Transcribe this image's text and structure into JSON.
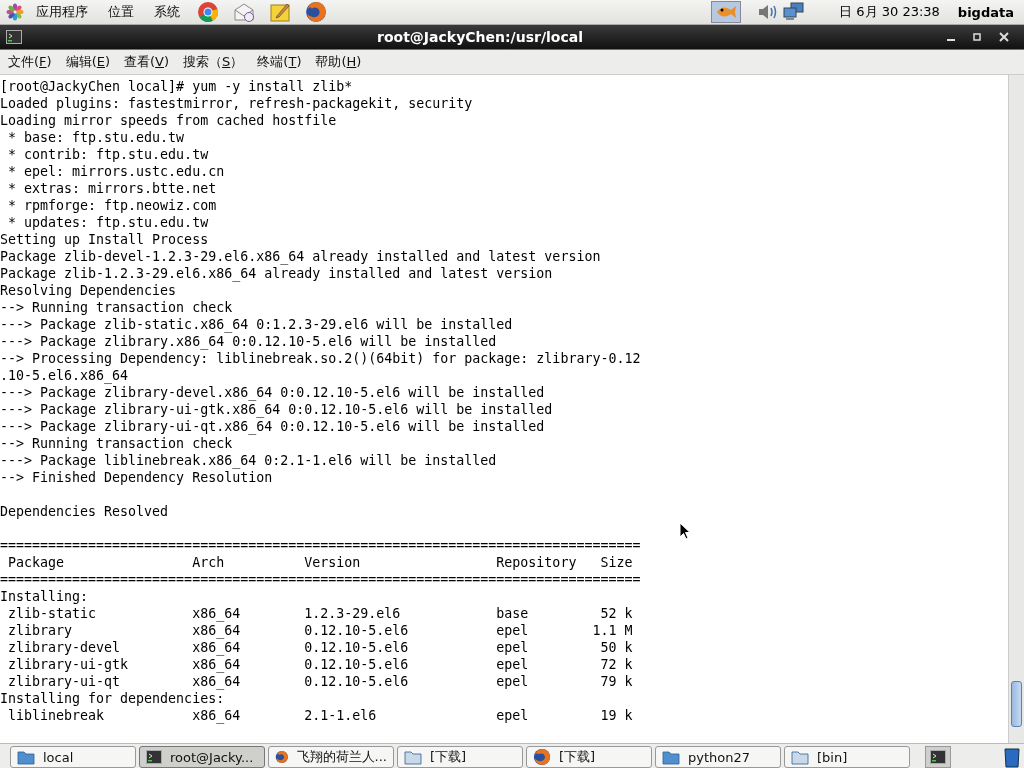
{
  "top_panel": {
    "menus": [
      "应用程序",
      "位置",
      "系统"
    ],
    "launchers": [
      {
        "kind": "chrome"
      },
      {
        "kind": "mail"
      },
      {
        "kind": "notes"
      },
      {
        "kind": "firefox"
      }
    ],
    "clock": "日 6月 30 23:38",
    "user": "bigdata"
  },
  "window": {
    "title": "root@JackyChen:/usr/local"
  },
  "menu_bar": [
    {
      "label": "文件(",
      "key": "F",
      "end": ")"
    },
    {
      "label": "编辑(",
      "key": "E",
      "end": ")"
    },
    {
      "label": "查看(",
      "key": "V",
      "end": ")"
    },
    {
      "label": "搜索（",
      "key": "S",
      "end": "）"
    },
    {
      "label": "终端(",
      "key": "T",
      "end": ")"
    },
    {
      "label": "帮助(",
      "key": "H",
      "end": ")"
    }
  ],
  "terminal_lines": [
    {
      "kind": "text",
      "text": "[root@JackyChen local]# yum -y install zlib*"
    },
    {
      "kind": "text",
      "text": "Loaded plugins: fastestmirror, refresh-packagekit, security"
    },
    {
      "kind": "text",
      "text": "Loading mirror speeds from cached hostfile"
    },
    {
      "kind": "text",
      "text": " * base: ftp.stu.edu.tw"
    },
    {
      "kind": "text",
      "text": " * contrib: ftp.stu.edu.tw"
    },
    {
      "kind": "text",
      "text": " * epel: mirrors.ustc.edu.cn"
    },
    {
      "kind": "text",
      "text": " * extras: mirrors.btte.net"
    },
    {
      "kind": "text",
      "text": " * rpmforge: ftp.neowiz.com"
    },
    {
      "kind": "text",
      "text": " * updates: ftp.stu.edu.tw"
    },
    {
      "kind": "text",
      "text": "Setting up Install Process"
    },
    {
      "kind": "text",
      "text": "Package zlib-devel-1.2.3-29.el6.x86_64 already installed and latest version"
    },
    {
      "kind": "text",
      "text": "Package zlib-1.2.3-29.el6.x86_64 already installed and latest version"
    },
    {
      "kind": "text",
      "text": "Resolving Dependencies"
    },
    {
      "kind": "text",
      "text": "--> Running transaction check"
    },
    {
      "kind": "text",
      "text": "---> Package zlib-static.x86_64 0:1.2.3-29.el6 will be installed"
    },
    {
      "kind": "text",
      "text": "---> Package zlibrary.x86_64 0:0.12.10-5.el6 will be installed"
    },
    {
      "kind": "text",
      "text": "--> Processing Dependency: liblinebreak.so.2()(64bit) for package: zlibrary-0.12"
    },
    {
      "kind": "text",
      "text": ".10-5.el6.x86_64"
    },
    {
      "kind": "text",
      "text": "---> Package zlibrary-devel.x86_64 0:0.12.10-5.el6 will be installed"
    },
    {
      "kind": "text",
      "text": "---> Package zlibrary-ui-gtk.x86_64 0:0.12.10-5.el6 will be installed"
    },
    {
      "kind": "text",
      "text": "---> Package zlibrary-ui-qt.x86_64 0:0.12.10-5.el6 will be installed"
    },
    {
      "kind": "text",
      "text": "--> Running transaction check"
    },
    {
      "kind": "text",
      "text": "---> Package liblinebreak.x86_64 0:2.1-1.el6 will be installed"
    },
    {
      "kind": "text",
      "text": "--> Finished Dependency Resolution"
    },
    {
      "kind": "blank"
    },
    {
      "kind": "text",
      "text": "Dependencies Resolved"
    },
    {
      "kind": "blank"
    },
    {
      "kind": "text",
      "text": "================================================================================"
    },
    {
      "kind": "text",
      "text": " Package                Arch          Version                 Repository   Size"
    },
    {
      "kind": "text",
      "text": "================================================================================"
    },
    {
      "kind": "text",
      "text": "Installing:"
    },
    {
      "kind": "text",
      "text": " zlib-static            x86_64        1.2.3-29.el6            base         52 k"
    },
    {
      "kind": "text",
      "text": " zlibrary               x86_64        0.12.10-5.el6           epel        1.1 M"
    },
    {
      "kind": "text",
      "text": " zlibrary-devel         x86_64        0.12.10-5.el6           epel         50 k"
    },
    {
      "kind": "text",
      "text": " zlibrary-ui-gtk        x86_64        0.12.10-5.el6           epel         72 k"
    },
    {
      "kind": "text",
      "text": " zlibrary-ui-qt         x86_64        0.12.10-5.el6           epel         79 k"
    },
    {
      "kind": "text",
      "text": "Installing for dependencies:"
    },
    {
      "kind": "text",
      "text": " liblinebreak           x86_64        2.1-1.el6               epel         19 k"
    }
  ],
  "taskbar": [
    {
      "label": "local",
      "kind": "folder",
      "selected": false
    },
    {
      "label": "root@Jacky...",
      "kind": "terminal",
      "selected": true
    },
    {
      "label": "飞翔的荷兰人...",
      "kind": "browser",
      "selected": false
    },
    {
      "label": "[下载]",
      "kind": "downloads",
      "selected": false
    },
    {
      "label": "[下载]",
      "kind": "browser",
      "selected": false
    },
    {
      "label": "python27",
      "kind": "folder",
      "selected": false
    },
    {
      "label": "[bin]",
      "kind": "downloads",
      "selected": false
    }
  ]
}
